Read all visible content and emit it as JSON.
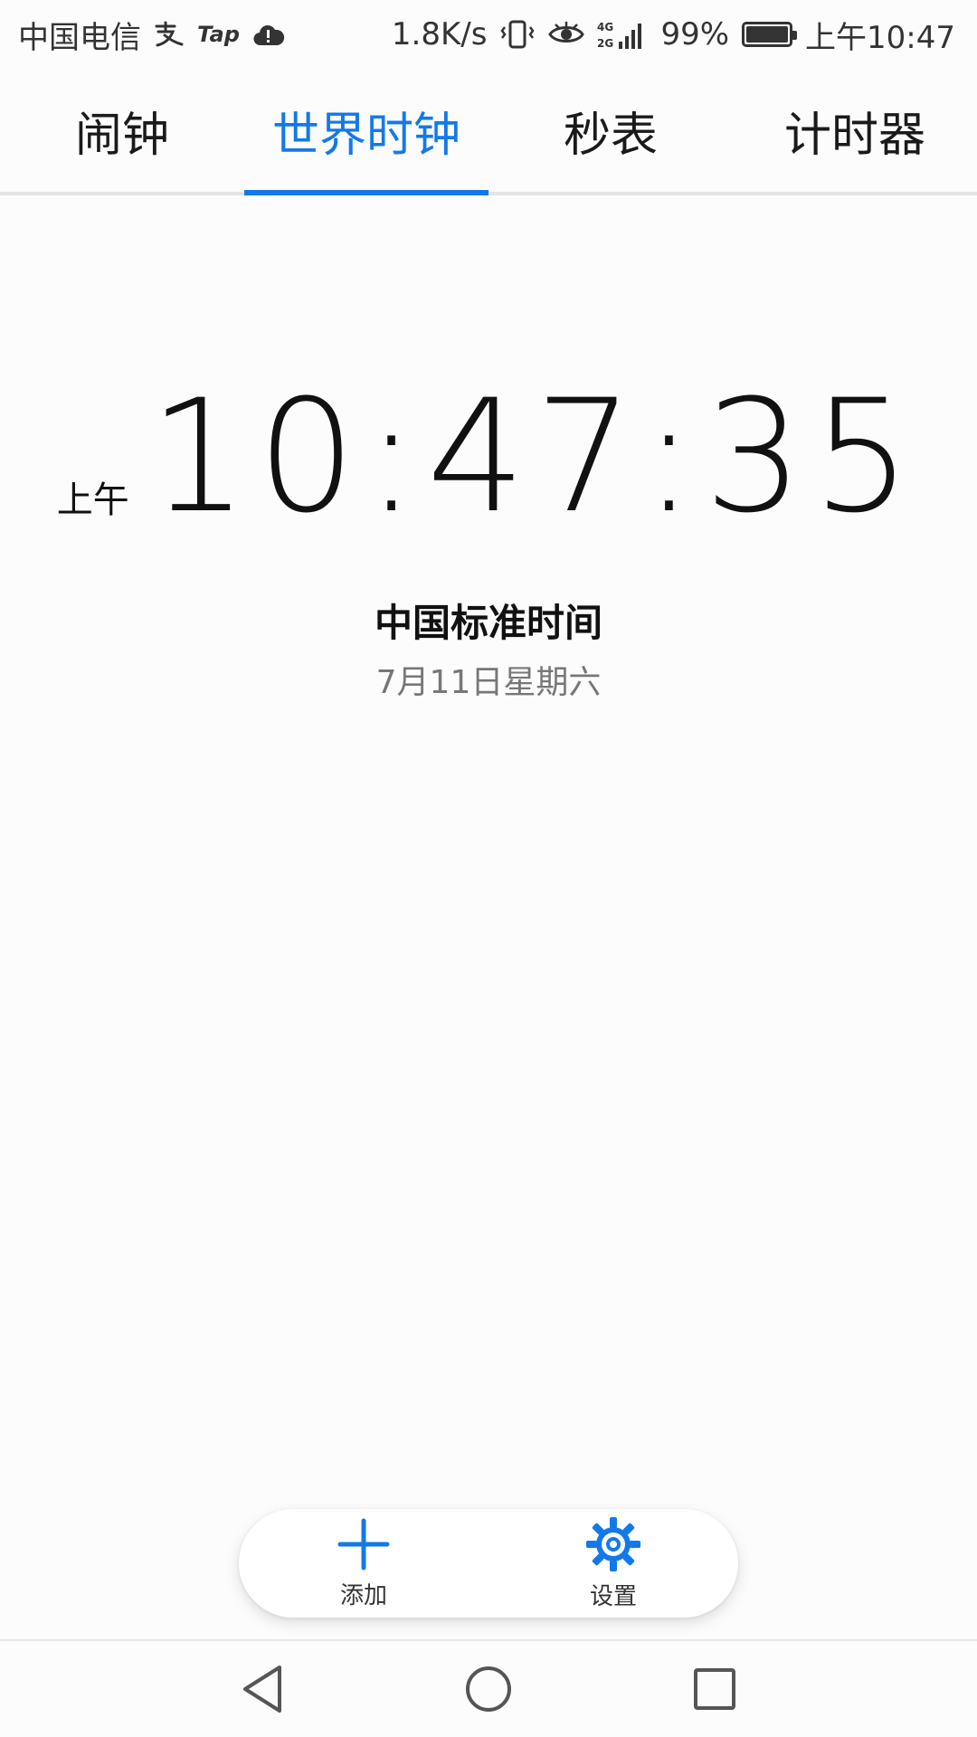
{
  "status_bar": {
    "carrier": "中国电信",
    "app_badge": "Tap",
    "net_speed": "1.8K/s",
    "network_type": "4G 2G",
    "battery_percent": "99%",
    "battery_level": 0.99,
    "time": "上午10:47",
    "icons": [
      "alipay-icon",
      "tap-icon",
      "cloud-alert-icon",
      "vibrate-icon",
      "eye-icon",
      "signal-icon",
      "battery-icon"
    ]
  },
  "tabs": [
    {
      "label": "闹钟",
      "active": false
    },
    {
      "label": "世界时钟",
      "active": true
    },
    {
      "label": "秒表",
      "active": false
    },
    {
      "label": "计时器",
      "active": false
    }
  ],
  "clock": {
    "ampm": "上午",
    "time": "10:47:35",
    "zone_name": "中国标准时间",
    "date": "7月11日星期六"
  },
  "actions": {
    "add_label": "添加",
    "settings_label": "设置"
  },
  "colors": {
    "accent": "#1479e8",
    "background": "#fcfcfc",
    "text": "#111111",
    "secondary_text": "#777777"
  }
}
